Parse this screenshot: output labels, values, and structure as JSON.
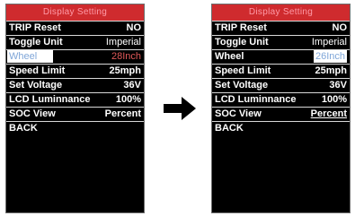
{
  "arrow_icon": "right-arrow-icon",
  "before": {
    "title": "Display Setting",
    "items": [
      {
        "label": "TRIP Reset",
        "value": "NO"
      },
      {
        "label": "Toggle Unit",
        "value": "Imperial"
      },
      {
        "label": "Wheel",
        "value": "28Inch"
      },
      {
        "label": "Speed Limit",
        "value": "25mph"
      },
      {
        "label": "Set Voltage",
        "value": "36V"
      },
      {
        "label": "LCD Luminnance",
        "value": "100%"
      },
      {
        "label": "SOC View",
        "value": "Percent"
      }
    ],
    "back": "BACK"
  },
  "after": {
    "title": "Display Setting",
    "items": [
      {
        "label": "TRIP Reset",
        "value": "NO"
      },
      {
        "label": "Toggle Unit",
        "value": "Imperial"
      },
      {
        "label": "Wheel",
        "value": "26Inch"
      },
      {
        "label": "Speed Limit",
        "value": "25mph"
      },
      {
        "label": "Set Voltage",
        "value": "36V"
      },
      {
        "label": "LCD Luminnance",
        "value": "100%"
      },
      {
        "label": "SOC View",
        "value": "Percent"
      }
    ],
    "back": "BACK"
  },
  "colors": {
    "title_bg": "#cf2b2e",
    "title_text": "#ff9ba8",
    "highlight_text": "#7fa6d8",
    "wheel_value_before": "#e25a5a"
  }
}
